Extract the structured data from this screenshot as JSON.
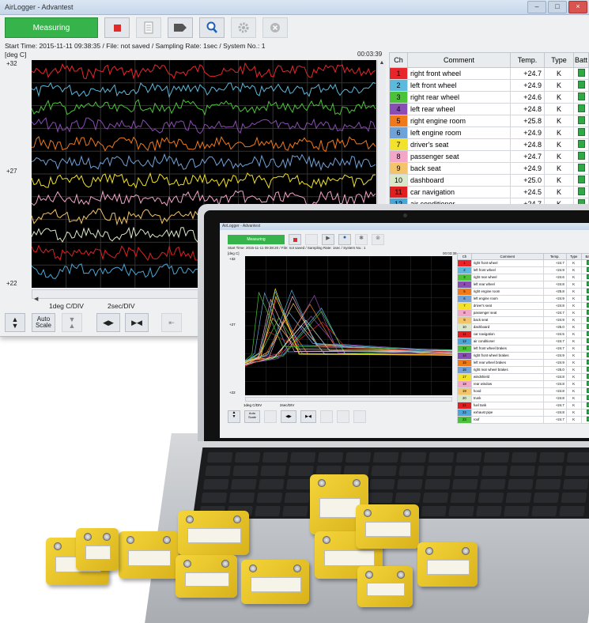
{
  "window": {
    "title": "AirLogger - Advantest",
    "measure_label": "Measuring",
    "info": "Start Time: 2015-11-11 09:38:35   / File: not saved   / Sampling Rate: 1sec / System No.: 1",
    "unit": "[deg C]",
    "timecode": "00:03:39",
    "y_labels": {
      "top": "+32",
      "mid": "+27",
      "bottom": "+22"
    },
    "y_div": "1deg C/DIV",
    "x_div": "2sec/DIV",
    "auto_scale": "Auto Scale"
  },
  "table": {
    "headers": [
      "Ch",
      "Comment",
      "Temp.",
      "Type",
      "Batt"
    ],
    "rows": [
      {
        "ch": "1",
        "comment": "right front wheel",
        "temp": "+24.7",
        "type": "K",
        "color": "#e8262a"
      },
      {
        "ch": "2",
        "comment": "left front wheel",
        "temp": "+24.9",
        "type": "K",
        "color": "#5ab9dd"
      },
      {
        "ch": "3",
        "comment": "right rear wheel",
        "temp": "+24.6",
        "type": "K",
        "color": "#4cc23b"
      },
      {
        "ch": "4",
        "comment": "left rear wheel",
        "temp": "+24.8",
        "type": "K",
        "color": "#8a4db3"
      },
      {
        "ch": "5",
        "comment": "right engine room",
        "temp": "+25.8",
        "type": "K",
        "color": "#f07a1a"
      },
      {
        "ch": "6",
        "comment": "left engine room",
        "temp": "+24.9",
        "type": "K",
        "color": "#6fa2d8"
      },
      {
        "ch": "7",
        "comment": "driver's seat",
        "temp": "+24.8",
        "type": "K",
        "color": "#f2e22c"
      },
      {
        "ch": "8",
        "comment": "passenger seat",
        "temp": "+24.7",
        "type": "K",
        "color": "#f4a6c9"
      },
      {
        "ch": "9",
        "comment": "back seat",
        "temp": "+24.9",
        "type": "K",
        "color": "#f4c46a"
      },
      {
        "ch": "10",
        "comment": "dashboard",
        "temp": "+25.0",
        "type": "K",
        "color": "#d9e8c8"
      },
      {
        "ch": "11",
        "comment": "car navigation",
        "temp": "+24.5",
        "type": "K",
        "color": "#e02020"
      },
      {
        "ch": "12",
        "comment": "air conditioner",
        "temp": "+24.7",
        "type": "K",
        "color": "#4aa6d6"
      }
    ]
  },
  "laptop_screen": {
    "title": "AirLogger - Advantest",
    "measure_label": "Measuring",
    "info": "Start Time: 2015-11-11 09:38:20  / File: not saved  / Sampling Rate: 1sec / System No.: 1",
    "unit": "[deg C]",
    "timecode": "00:03:39",
    "y_labels": {
      "top": "+32",
      "mid": "+27",
      "bottom": "+22"
    },
    "y_div": "1deg C/DIV",
    "x_div": "2sec/DIV",
    "auto_scale": "Auto Scale",
    "headers": [
      "Ch",
      "Comment",
      "Temp.",
      "Type",
      "Batt"
    ],
    "rows": [
      {
        "ch": "1",
        "comment": "right front wheel",
        "temp": "+24.7",
        "type": "K",
        "color": "#e8262a"
      },
      {
        "ch": "2",
        "comment": "left front wheel",
        "temp": "+24.9",
        "type": "K",
        "color": "#5ab9dd"
      },
      {
        "ch": "3",
        "comment": "right rear wheel",
        "temp": "+24.6",
        "type": "K",
        "color": "#4cc23b"
      },
      {
        "ch": "4",
        "comment": "left rear wheel",
        "temp": "+24.8",
        "type": "K",
        "color": "#8a4db3"
      },
      {
        "ch": "5",
        "comment": "right engine room",
        "temp": "+25.8",
        "type": "K",
        "color": "#f07a1a"
      },
      {
        "ch": "6",
        "comment": "left engine room",
        "temp": "+24.9",
        "type": "K",
        "color": "#6fa2d8"
      },
      {
        "ch": "7",
        "comment": "driver's seat",
        "temp": "+24.8",
        "type": "K",
        "color": "#f2e22c"
      },
      {
        "ch": "8",
        "comment": "passenger seat",
        "temp": "+24.7",
        "type": "K",
        "color": "#f4a6c9"
      },
      {
        "ch": "9",
        "comment": "back seat",
        "temp": "+24.9",
        "type": "K",
        "color": "#f4c46a"
      },
      {
        "ch": "10",
        "comment": "dashboard",
        "temp": "+25.0",
        "type": "K",
        "color": "#d9e8c8"
      },
      {
        "ch": "11",
        "comment": "car navigation",
        "temp": "+24.5",
        "type": "K",
        "color": "#e02020"
      },
      {
        "ch": "12",
        "comment": "air conditioner",
        "temp": "+24.7",
        "type": "K",
        "color": "#4aa6d6"
      },
      {
        "ch": "13",
        "comment": "left front wheel brakes",
        "temp": "+24.7",
        "type": "K",
        "color": "#4cc23b"
      },
      {
        "ch": "14",
        "comment": "right front wheel brakes",
        "temp": "+24.9",
        "type": "K",
        "color": "#8a4db3"
      },
      {
        "ch": "15",
        "comment": "left rear wheel brakes",
        "temp": "+24.9",
        "type": "K",
        "color": "#f07a1a"
      },
      {
        "ch": "16",
        "comment": "right rear wheel brakes",
        "temp": "+25.0",
        "type": "K",
        "color": "#6fa2d8"
      },
      {
        "ch": "17",
        "comment": "windshield",
        "temp": "+24.8",
        "type": "K",
        "color": "#f2e22c"
      },
      {
        "ch": "18",
        "comment": "rear window",
        "temp": "+24.8",
        "type": "K",
        "color": "#f4a6c9"
      },
      {
        "ch": "19",
        "comment": "hood",
        "temp": "+24.8",
        "type": "K",
        "color": "#f4c46a"
      },
      {
        "ch": "20",
        "comment": "trunk",
        "temp": "+24.8",
        "type": "K",
        "color": "#d9e8c8"
      },
      {
        "ch": "21",
        "comment": "fuel tank",
        "temp": "+24.7",
        "type": "K",
        "color": "#e02020"
      },
      {
        "ch": "22",
        "comment": "exhaust pipe",
        "temp": "+24.8",
        "type": "K",
        "color": "#4aa6d6"
      },
      {
        "ch": "23",
        "comment": "roof",
        "temp": "+24.7",
        "type": "K",
        "color": "#4cc23b"
      }
    ]
  },
  "icons": {
    "stop": "stop-square-icon",
    "export": "document-icon",
    "marker": "tag-icon",
    "zoom": "magnifier-icon",
    "settings": "gear-icon",
    "close": "close-circle-icon"
  },
  "colors": {
    "measuring": "#36b34a",
    "battery": "#31a846",
    "chart_bg": "#000000"
  }
}
